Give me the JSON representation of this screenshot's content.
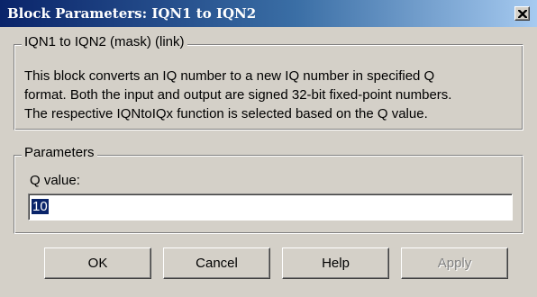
{
  "window": {
    "title": "Block Parameters: IQN1 to IQN2"
  },
  "mask_group": {
    "legend": "IQN1 to IQN2 (mask) (link)",
    "description_lines": [
      "This block converts an IQ number to a new IQ number in specified Q",
      "format. Both the input and output are signed 32-bit fixed-point numbers.",
      "The respective IQNtoIQx function is selected based on the Q value."
    ]
  },
  "parameters_group": {
    "legend": "Parameters",
    "q_label": "Q value:",
    "q_value": "10"
  },
  "buttons": {
    "ok": "OK",
    "cancel": "Cancel",
    "help": "Help",
    "apply": "Apply"
  },
  "colors": {
    "title_bar_start": "#0a246a",
    "title_bar_end": "#a6caf0",
    "dialog_face": "#d4d0c8",
    "selection": "#0a246a",
    "disabled_text": "#808080"
  },
  "icons": {
    "close": "close-icon"
  }
}
